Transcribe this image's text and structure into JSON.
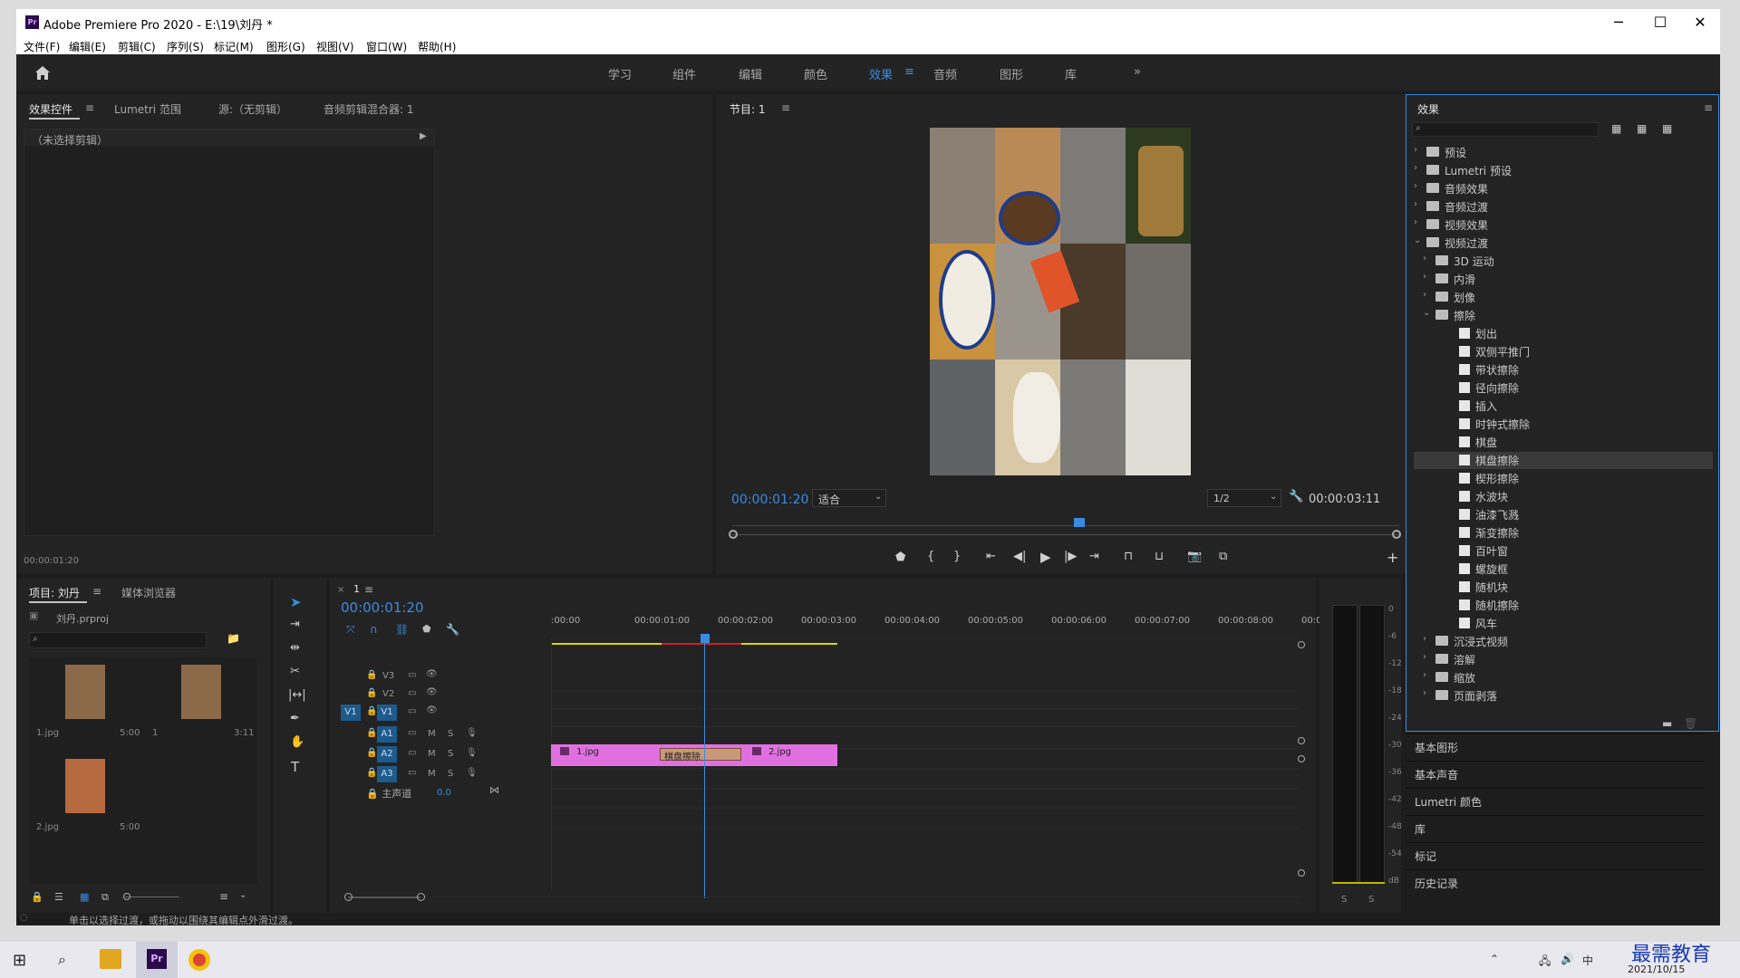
{
  "titlebar": {
    "title": "Adobe Premiere Pro 2020 - E:\\19\\刘丹 *",
    "app_badge": "Pr",
    "minimize": "─",
    "maximize": "☐",
    "close": "✕"
  },
  "menu": [
    "文件(F)",
    "编辑(E)",
    "剪辑(C)",
    "序列(S)",
    "标记(M)",
    "图形(G)",
    "视图(V)",
    "窗口(W)",
    "帮助(H)"
  ],
  "workspaces": {
    "items": [
      "学习",
      "组件",
      "编辑",
      "颜色",
      "效果",
      "音频",
      "图形",
      "库"
    ],
    "active": "效果",
    "more": "»"
  },
  "source_panel": {
    "tabs": [
      "效果控件",
      "Lumetri 范围",
      "源:（无剪辑）",
      "音频剪辑混合器: 1"
    ],
    "no_clip": "（未选择剪辑）",
    "timecode": "00:00:01:20"
  },
  "program": {
    "title": "节目: 1",
    "timecode": "00:00:01:20",
    "fit": "适合",
    "resolution": "1/2",
    "duration": "00:00:03:11",
    "playhead_fraction": 0.52
  },
  "project": {
    "tabs": [
      "项目: 刘丹",
      "媒体浏览器"
    ],
    "file": "刘丹.prproj",
    "items": [
      {
        "name": "1.jpg",
        "duration": "5:00"
      },
      {
        "name": "1",
        "duration": "3:11"
      },
      {
        "name": "2.jpg",
        "duration": "5:00"
      }
    ]
  },
  "timeline": {
    "tab": "1",
    "timecode": "00:00:01:20",
    "ruler": [
      ":00:00",
      "00:00:01:00",
      "00:00:02:00",
      "00:00:03:00",
      "00:00:04:00",
      "00:00:05:00",
      "00:00:06:00",
      "00:00:07:00",
      "00:00:08:00",
      "00:0"
    ],
    "video_tracks": [
      "V3",
      "V2",
      "V1"
    ],
    "audio_tracks": [
      "A1",
      "A2",
      "A3"
    ],
    "source_patch": "V1",
    "master": {
      "label": "主声道",
      "value": "0.0"
    },
    "clips": [
      {
        "name": "1.jpg"
      },
      {
        "name": "棋盘擦除"
      },
      {
        "name": "2.jpg"
      }
    ],
    "track_toggles": {
      "mute": "M",
      "solo": "S"
    }
  },
  "meters": {
    "scale": [
      "0",
      "-6",
      "-12",
      "-18",
      "-24",
      "-30",
      "-36",
      "-42",
      "-48",
      "-54",
      "dB"
    ],
    "solo": [
      "S",
      "S"
    ]
  },
  "effects_panel": {
    "title": "效果",
    "tree": [
      {
        "label": "预设",
        "level": 0,
        "kind": "folder",
        "open": false
      },
      {
        "label": "Lumetri 预设",
        "level": 0,
        "kind": "folder",
        "open": false
      },
      {
        "label": "音频效果",
        "level": 0,
        "kind": "folder",
        "open": false
      },
      {
        "label": "音频过渡",
        "level": 0,
        "kind": "folder",
        "open": false
      },
      {
        "label": "视频效果",
        "level": 0,
        "kind": "folder",
        "open": false
      },
      {
        "label": "视频过渡",
        "level": 0,
        "kind": "folder",
        "open": true
      },
      {
        "label": "3D 运动",
        "level": 1,
        "kind": "folder",
        "open": false
      },
      {
        "label": "内滑",
        "level": 1,
        "kind": "folder",
        "open": false
      },
      {
        "label": "划像",
        "level": 1,
        "kind": "folder",
        "open": false
      },
      {
        "label": "擦除",
        "level": 1,
        "kind": "folder",
        "open": true
      },
      {
        "label": "划出",
        "level": 2,
        "kind": "item"
      },
      {
        "label": "双侧平推门",
        "level": 2,
        "kind": "item"
      },
      {
        "label": "带状擦除",
        "level": 2,
        "kind": "item"
      },
      {
        "label": "径向擦除",
        "level": 2,
        "kind": "item"
      },
      {
        "label": "插入",
        "level": 2,
        "kind": "item"
      },
      {
        "label": "时钟式擦除",
        "level": 2,
        "kind": "item"
      },
      {
        "label": "棋盘",
        "level": 2,
        "kind": "item"
      },
      {
        "label": "棋盘擦除",
        "level": 2,
        "kind": "item",
        "selected": true
      },
      {
        "label": "楔形擦除",
        "level": 2,
        "kind": "item"
      },
      {
        "label": "水波块",
        "level": 2,
        "kind": "item"
      },
      {
        "label": "油漆飞溅",
        "level": 2,
        "kind": "item"
      },
      {
        "label": "渐变擦除",
        "level": 2,
        "kind": "item"
      },
      {
        "label": "百叶窗",
        "level": 2,
        "kind": "item"
      },
      {
        "label": "螺旋框",
        "level": 2,
        "kind": "item"
      },
      {
        "label": "随机块",
        "level": 2,
        "kind": "item"
      },
      {
        "label": "随机擦除",
        "level": 2,
        "kind": "item"
      },
      {
        "label": "风车",
        "level": 2,
        "kind": "item"
      },
      {
        "label": "沉浸式视频",
        "level": 1,
        "kind": "folder",
        "open": false
      },
      {
        "label": "溶解",
        "level": 1,
        "kind": "folder",
        "open": false
      },
      {
        "label": "缩放",
        "level": 1,
        "kind": "folder",
        "open": false
      },
      {
        "label": "页面剥落",
        "level": 1,
        "kind": "folder",
        "open": false
      }
    ]
  },
  "side_panels": [
    "基本图形",
    "基本声音",
    "Lumetri 颜色",
    "库",
    "标记",
    "历史记录"
  ],
  "status": "单击以选择过渡，或拖动以围绕其编辑点外滑过渡。",
  "taskbar": {
    "date": "2021/10/15",
    "ime": "中",
    "brand": "最需教育"
  },
  "colors": {
    "accent": "#3a8be0",
    "clip": "#e070e0",
    "track_active": "#1d5a8c"
  }
}
